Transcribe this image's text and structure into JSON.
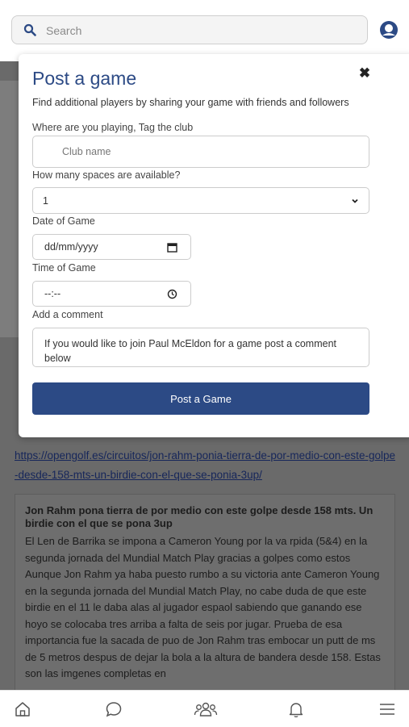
{
  "search": {
    "placeholder": "Search",
    "icon": "search-icon"
  },
  "avatar": {
    "icon": "user-avatar"
  },
  "background": {
    "link_text": "https://opengolf.es/circuitos/jon-rahm-ponia-tierra-de-por-medio-con-este-golpe-desde-158-mts-un-birdie-con-el-que-se-ponia-3up/",
    "article_title": "Jon Rahm pona tierra de por medio con este golpe desde 158 mts. Un birdie con el que se pona 3up",
    "article_body": "El Len de Barrika se impona a Cameron Young por la va rpida (5&4) en la segunda jornada del Mundial Match Play gracias a golpes como estos Aunque Jon Rahm ya haba puesto rumbo a su victoria ante Cameron Young en la segunda jornada del Mundial Match Play, no cabe duda de que este birdie en el 11 le daba alas al jugador espaol sabiendo que ganando ese hoyo se colocaba tres arriba a falta de seis por jugar. Prueba de esa importancia fue la sacada de puo de Jon Rahm tras embocar un putt de ms de 5 metros despus de dejar la bola a la altura de bandera desde 158. Estas son las imgenes completas en"
  },
  "modal": {
    "title": "Post a game",
    "close_symbol": "✖",
    "subtitle": "Find additional players by sharing your game with friends and followers",
    "club_label": "Where are you playing, Tag the club",
    "club_placeholder": "Club name",
    "spaces_label": "How many spaces are available?",
    "spaces_value": "1",
    "date_label": "Date of Game",
    "date_value": "dd/mm/yyyy",
    "time_label": "Time of Game",
    "time_value": "--:--",
    "comment_label": "Add a comment",
    "comment_placeholder": "If you would like to join Paul McEldon for a game post a comment below",
    "submit_label": "Post a Game"
  },
  "colors": {
    "primary": "#2c4a85",
    "link": "#16265a",
    "overlay": "#6a6a6a"
  },
  "bottom_nav": [
    "home-icon",
    "chat-icon",
    "group-icon",
    "bell-icon",
    "menu-icon"
  ]
}
